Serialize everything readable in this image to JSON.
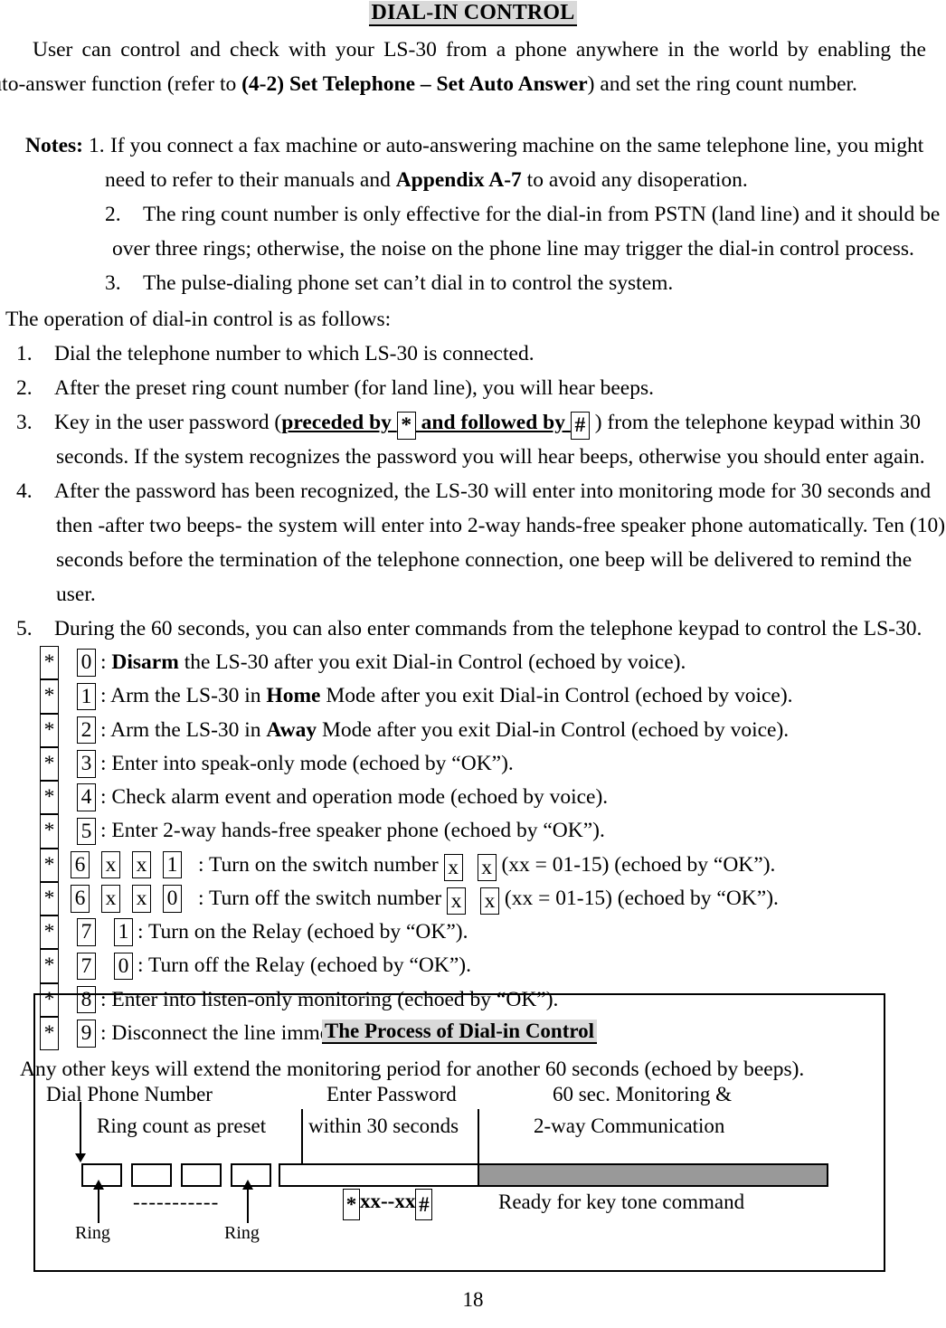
{
  "document": {
    "title": "DIAL-IN CONTROL",
    "page_number": "18"
  },
  "intro": {
    "line1": "User can control and check with your LS-30 from a phone anywhere in the world by enabling the",
    "line2_a": "auto-answer function (refer to ",
    "line2_b": "(4-2) Set Telephone – Set Auto Answer",
    "line2_c": ") and set the ring count number."
  },
  "notes": {
    "label": "Notes:",
    "items": [
      {
        "number": "1.",
        "line1": "If you connect a fax machine or auto-answering machine on the same telephone line, you might",
        "line2_a": "need to refer to their manuals and ",
        "line2_b": "Appendix A-7",
        "line2_c": " to avoid any disoperation."
      },
      {
        "number": "2.",
        "line1": "The ring count number is only effective for the dial-in from PSTN (land line) and it should be",
        "line2_a": "over three rings; otherwise, the noise on the phone line may trigger the dial-in control process.",
        "line2_b": "",
        "line2_c": ""
      },
      {
        "number": "3.",
        "line1": "The pulse-dialing phone set can’t dial in to control the system.",
        "line2_a": "",
        "line2_b": "",
        "line2_c": ""
      }
    ]
  },
  "operation": {
    "lead": "The operation of dial-in control is as follows:",
    "steps": [
      {
        "number": "1.",
        "text": "Dial the telephone number to which LS-30 is connected."
      },
      {
        "number": "2.",
        "text": "After the preset ring count number (for land line), you will hear beeps."
      },
      {
        "number": "3.",
        "text_a": "Key in the user password (",
        "bold_a": "preceded by ",
        "key_star": "*",
        "bold_b": " and followed by ",
        "key_hash": "#",
        "text_b": " ) from the telephone keypad within 30",
        "cont": "seconds. If the system recognizes the password you will hear beeps, otherwise you should enter again."
      },
      {
        "number": "4.",
        "text": "After the password has been recognized, the LS-30 will enter into monitoring mode for 30 seconds and",
        "cont1": "then -after two beeps- the system will enter into 2-way hands-free speaker phone automatically. Ten (10)",
        "cont2": "seconds before the termination of the telephone connection, one beep will be delivered to remind the user."
      },
      {
        "number": "5.",
        "text": "During the 60 seconds, you can also enter commands from the telephone keypad to control the LS-30."
      }
    ]
  },
  "commands": [
    {
      "keys": [
        "*",
        "0"
      ],
      "prefix": ": ",
      "bold": "Disarm",
      "suffix": " the LS-30 after you exit Dial-in Control (echoed by voice)."
    },
    {
      "keys": [
        "*",
        "1"
      ],
      "prefix": ": Arm the LS-30 in ",
      "bold": "Home",
      "suffix": " Mode after you exit Dial-in Control (echoed by voice)."
    },
    {
      "keys": [
        "*",
        "2"
      ],
      "prefix": ": Arm the LS-30 in ",
      "bold": "Away",
      "suffix": " Mode after you exit Dial-in Control (echoed by voice)."
    },
    {
      "keys": [
        "*",
        "3"
      ],
      "prefix": ": Enter into speak-only mode (echoed by “OK”).",
      "bold": "",
      "suffix": ""
    },
    {
      "keys": [
        "*",
        "4"
      ],
      "prefix": ": Check alarm event and operation mode (echoed by voice).",
      "bold": "",
      "suffix": ""
    },
    {
      "keys": [
        "*",
        "5"
      ],
      "prefix": ": Enter 2-way hands-free speaker phone (echoed by “OK”).",
      "bold": "",
      "suffix": ""
    }
  ],
  "switch_commands": [
    {
      "keys": [
        "*",
        "6",
        "x",
        "x",
        "1"
      ],
      "text_a": ": Turn on the switch number ",
      "inline_keys": [
        "x",
        "x"
      ],
      "text_b": " (xx = 01-15) (echoed by “OK”)."
    },
    {
      "keys": [
        "*",
        "6",
        "x",
        "x",
        "0"
      ],
      "text_a": ": Turn off the switch number ",
      "inline_keys": [
        "x",
        "x"
      ],
      "text_b": " (xx = 01-15) (echoed by “OK”)."
    }
  ],
  "relay_commands": [
    {
      "keys": [
        "*",
        "7",
        "1"
      ],
      "text": ": Turn on the Relay (echoed by “OK”)."
    },
    {
      "keys": [
        "*",
        "7",
        "0"
      ],
      "text": ": Turn off the Relay (echoed by “OK”)."
    }
  ],
  "final_commands": [
    {
      "keys": [
        "*",
        "8"
      ],
      "text": ": Enter into listen-only monitoring (echoed by “OK”)."
    },
    {
      "keys": [
        "*",
        "9"
      ],
      "text": ": Disconnect the line immediately."
    }
  ],
  "tail": "Any other keys will extend the monitoring period for another 60 seconds (echoed by beeps).",
  "diagram": {
    "title": "The Process of Dial-in Control",
    "labels": {
      "dial_phone": "Dial Phone Number",
      "ring_count": "Ring count as preset",
      "enter_password": "Enter Password",
      "within_30": "within 30 seconds",
      "monitoring": "60 sec. Monitoring &",
      "two_way": "2-way Communication",
      "ring_left": "Ring",
      "ring_right": "Ring",
      "dashes": "-----------",
      "code_star": "*",
      "code_mid": "xx--xx",
      "code_hash": "#",
      "ready": "Ready for key tone command"
    },
    "colors": {
      "gray_bar": "#999999",
      "highlight": "#d9d9d9"
    }
  }
}
